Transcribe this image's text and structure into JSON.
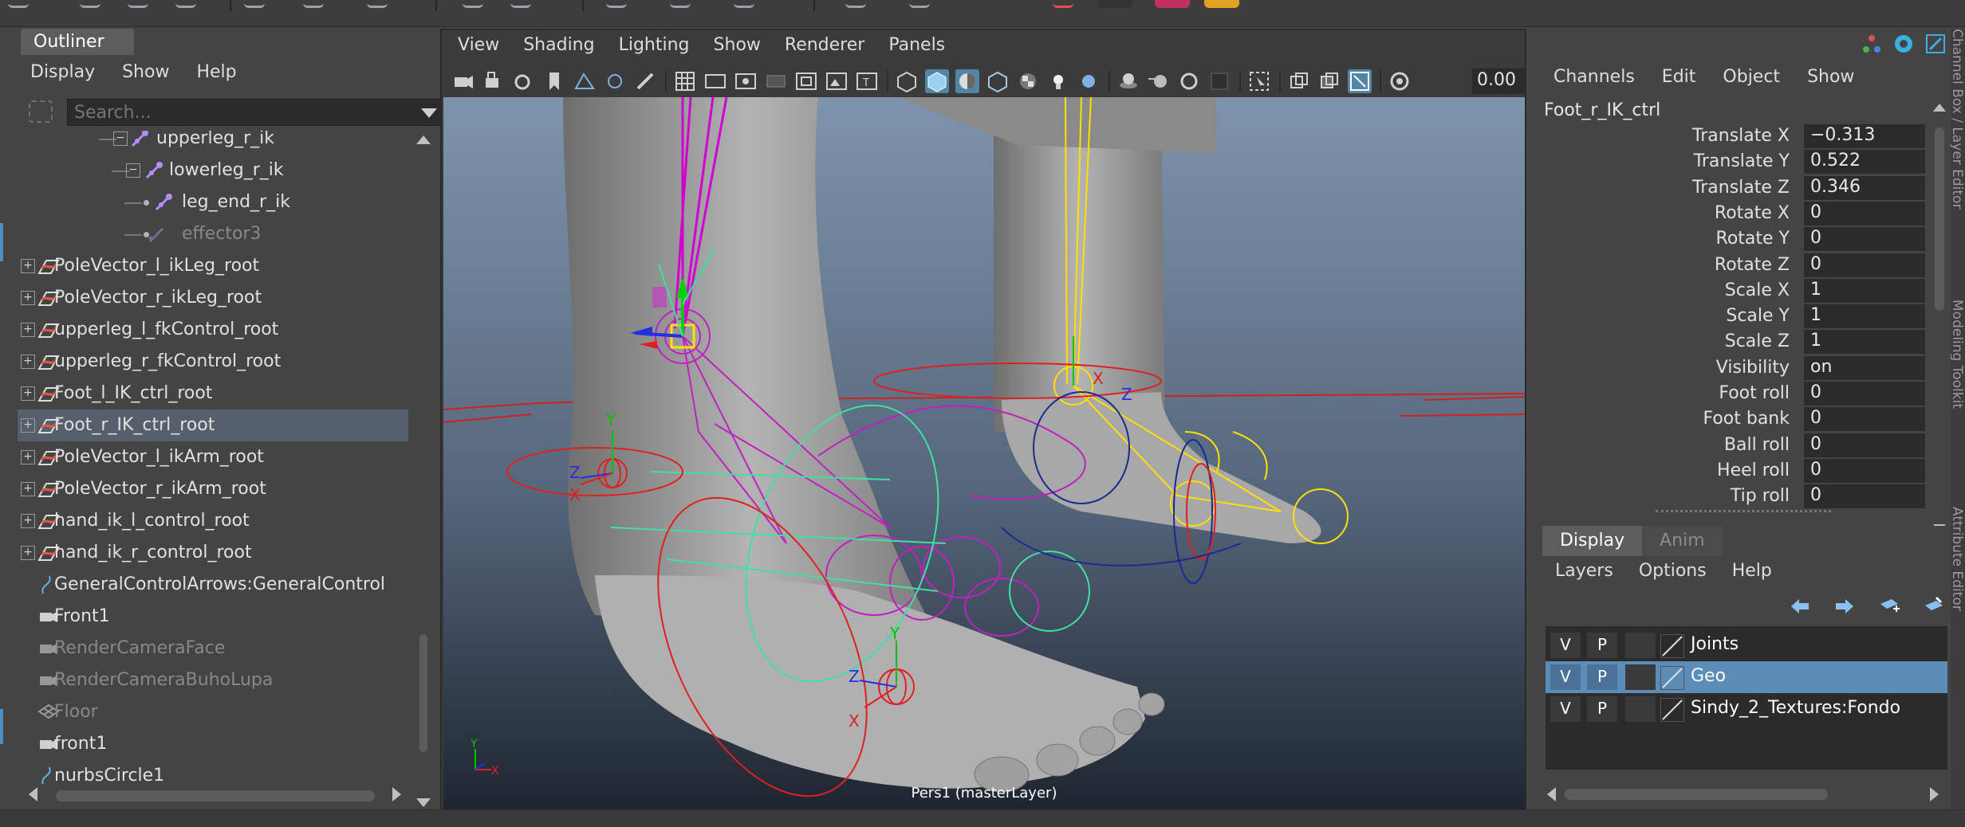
{
  "colors": {
    "selection": "#56606c",
    "layer_selection": "#5c8cb8",
    "accent": "#5285a6",
    "ik_icon": "#b48cff",
    "transform_icon": "#e05a4a"
  },
  "outliner": {
    "tab_label": "Outliner",
    "menu": [
      "Display",
      "Show",
      "Help"
    ],
    "search_placeholder": "Search...",
    "items": [
      {
        "label": "upperleg_r_ik",
        "icon": "ik-joint-icon"
      },
      {
        "label": "lowerleg_r_ik",
        "icon": "ik-joint-icon"
      },
      {
        "label": "leg_end_r_ik",
        "icon": "ik-joint-icon"
      },
      {
        "label": "effector3",
        "icon": "ik-effector-icon",
        "dim": true
      },
      {
        "label": "PoleVector_l_ikLeg_root",
        "icon": "transform-icon"
      },
      {
        "label": "PoleVector_r_ikLeg_root",
        "icon": "transform-icon"
      },
      {
        "label": "upperleg_l_fkControl_root",
        "icon": "transform-icon"
      },
      {
        "label": "upperleg_r_fkControl_root",
        "icon": "transform-icon"
      },
      {
        "label": "Foot_l_IK_ctrl_root",
        "icon": "transform-icon"
      },
      {
        "label": "Foot_r_IK_ctrl_root",
        "icon": "transform-icon",
        "selected": true
      },
      {
        "label": "PoleVector_l_ikArm_root",
        "icon": "transform-icon"
      },
      {
        "label": "PoleVector_r_ikArm_root",
        "icon": "transform-icon"
      },
      {
        "label": "hand_ik_l_control_root",
        "icon": "transform-icon"
      },
      {
        "label": "hand_ik_r_control_root",
        "icon": "transform-icon"
      },
      {
        "label": "GeneralControlArrows:GeneralControl",
        "icon": "curve-icon"
      },
      {
        "label": "Front1",
        "icon": "camera-icon"
      },
      {
        "label": "RenderCameraFace",
        "icon": "camera-icon",
        "dim": true
      },
      {
        "label": "RenderCameraBuhoLupa",
        "icon": "camera-icon",
        "dim": true
      },
      {
        "label": "Floor",
        "icon": "mesh-icon",
        "dim": true
      },
      {
        "label": "front1",
        "icon": "camera-icon"
      },
      {
        "label": "nurbsCircle1",
        "icon": "curve-icon"
      }
    ]
  },
  "viewport": {
    "menu": [
      "View",
      "Shading",
      "Lighting",
      "Show",
      "Renderer",
      "Panels"
    ],
    "value_field": "0.00",
    "camera_label": "Pers1 (masterLayer)",
    "axis_labels": {
      "x": "X",
      "y": "Y",
      "z": "Z"
    }
  },
  "channelbox": {
    "menu": [
      "Channels",
      "Edit",
      "Object",
      "Show"
    ],
    "node": "Foot_r_IK_ctrl",
    "channels": [
      {
        "name": "Translate X",
        "value": "−0.313"
      },
      {
        "name": "Translate Y",
        "value": "0.522"
      },
      {
        "name": "Translate Z",
        "value": "0.346"
      },
      {
        "name": "Rotate X",
        "value": "0"
      },
      {
        "name": "Rotate Y",
        "value": "0"
      },
      {
        "name": "Rotate Z",
        "value": "0"
      },
      {
        "name": "Scale X",
        "value": "1"
      },
      {
        "name": "Scale Y",
        "value": "1"
      },
      {
        "name": "Scale Z",
        "value": "1"
      },
      {
        "name": "Visibility",
        "value": "on"
      },
      {
        "name": "Foot  roll",
        "value": "0"
      },
      {
        "name": "Foot  bank",
        "value": "0"
      },
      {
        "name": "Ball  roll",
        "value": "0"
      },
      {
        "name": "Heel  roll",
        "value": "0"
      },
      {
        "name": "Tip  roll",
        "value": "0"
      }
    ]
  },
  "side_tabs": [
    "Channel Box / Layer Editor",
    "Modeling Toolkit",
    "Attribute Editor"
  ],
  "layers": {
    "tabs": [
      "Display",
      "Anim"
    ],
    "menu": [
      "Layers",
      "Options",
      "Help"
    ],
    "list": [
      {
        "v": "V",
        "p": "P",
        "name": "Joints"
      },
      {
        "v": "V",
        "p": "P",
        "name": "Geo",
        "selected": true
      },
      {
        "v": "V",
        "p": "P",
        "name": "Sindy_2_Textures:Fondo"
      }
    ]
  }
}
